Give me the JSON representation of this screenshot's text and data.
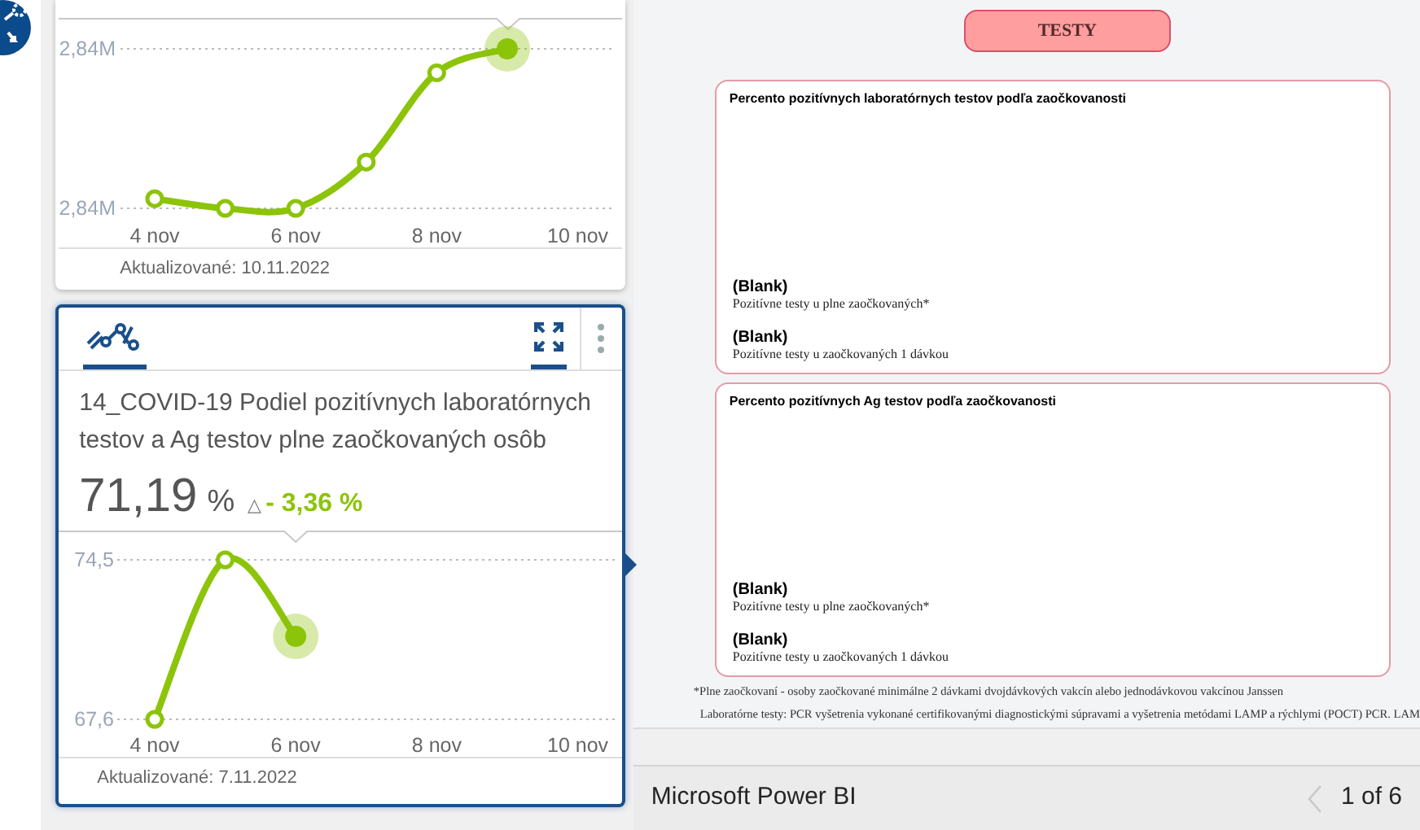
{
  "top_card": {
    "chart": {
      "y_labels": [
        "2,84M",
        "2,84M"
      ],
      "x_labels": [
        "4 nov",
        "6 nov",
        "8 nov",
        "10 nov"
      ]
    },
    "updated": "Aktualizované: 10.11.2022"
  },
  "card": {
    "selected": true,
    "title": "14_COVID-19 Podiel pozitívnych laboratórnych testov a Ag testov plne zaočkovaných osôb",
    "value": "71,19",
    "unit": "%",
    "delta_symbol": "△",
    "delta": "- 3,36 %",
    "chart_data": {
      "type": "line",
      "categories": [
        "4 nov",
        null,
        "6 nov",
        null,
        "8 nov",
        null,
        "10 nov"
      ],
      "series": [
        {
          "color": "#8cc40a",
          "marker": "circle",
          "values": [
            67.6,
            74.5,
            71.19,
            null,
            null,
            null,
            null
          ]
        }
      ],
      "ylim": [
        67.6,
        74.5
      ],
      "yticks": [
        {
          "value": 74.5,
          "label": "74,5"
        },
        {
          "value": 67.6,
          "label": "67,6"
        }
      ]
    },
    "updated": "Aktualizované: 7.11.2022"
  },
  "report": {
    "title_button": "TESTY",
    "panels": [
      {
        "title": "Percento pozitívnych laboratórnych testov podľa zaočkovanosti",
        "legend": [
          {
            "value": "(Blank)",
            "label": "Pozitívne testy u plne zaočkovaných*"
          },
          {
            "value": "(Blank)",
            "label": "Pozitívne testy u zaočkovaných 1 dávkou"
          }
        ]
      },
      {
        "title": "Percento pozitívnych Ag testov podľa zaočkovanosti",
        "legend": [
          {
            "value": "(Blank)",
            "label": "Pozitívne testy u plne zaočkovaných*"
          },
          {
            "value": "(Blank)",
            "label": "Pozitívne testy u zaočkovaných 1 dávkou"
          }
        ]
      }
    ],
    "footnotes": [
      "*Plne zaočkovaní - osoby zaočkované minimálne 2 dávkami dvojdávkových vakcín alebo jednodávkovou vakcínou Janssen",
      "Laboratórne testy: PCR vyšetrenia vykonané certifikovanými diagnostickými súpravami a vyšetrenia metódami LAMP a rýchlymi (POCT) PCR. LAM"
    ]
  },
  "status_bar": {
    "app": "Microsoft Power BI",
    "page": "1 of 6"
  }
}
